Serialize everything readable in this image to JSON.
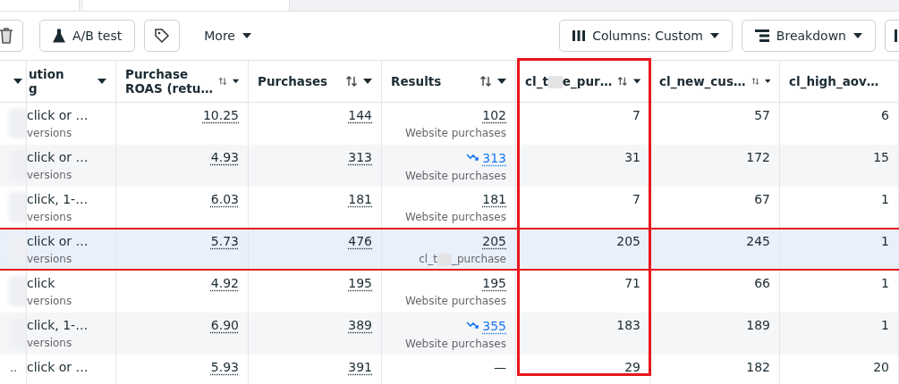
{
  "toolbar": {
    "left": [
      {
        "kind": "trash"
      },
      {
        "kind": "abtest",
        "label": "A/B test"
      },
      {
        "kind": "tag"
      },
      {
        "kind": "menu",
        "label": "More"
      }
    ],
    "right": [
      {
        "kind": "columns",
        "label": "Columns: Custom"
      },
      {
        "kind": "breakdown",
        "label": "Breakdown"
      },
      {
        "kind": "bar"
      }
    ]
  },
  "table": {
    "columns": [
      {
        "kind": "cut"
      },
      {
        "kind": "text",
        "lines": [
          "ution",
          "g"
        ]
      },
      {
        "kind": "num",
        "lines": [
          "Purchase",
          "ROAS (retu…"
        ],
        "highlighted": false
      },
      {
        "kind": "num",
        "lines": [
          "Purchases"
        ],
        "highlighted": false
      },
      {
        "kind": "num",
        "lines": [
          "Results"
        ],
        "highlighted": false
      },
      {
        "kind": "redacted",
        "lines": [
          "cl_t",
          "e_pur…"
        ],
        "highlighted": true
      },
      {
        "kind": "num",
        "lines": [
          "cl_new_cus…"
        ],
        "highlighted": false
      },
      {
        "kind": "num",
        "lines": [
          "cl_high_aov…"
        ],
        "highlighted": false
      }
    ],
    "rows": [
      {
        "selected": false,
        "attribution": "click or …",
        "attribution_sub": "versions",
        "roas": "10.25",
        "purchases": "144",
        "result": "102",
        "result_trend": false,
        "result_sub": [
          "Website purchases"
        ],
        "col_5": "7",
        "col_6": "57",
        "col_7": "6"
      },
      {
        "selected": false,
        "attribution": "click or …",
        "attribution_sub": "versions",
        "roas": "4.93",
        "purchases": "313",
        "result": "313",
        "result_trend": true,
        "result_sub": [
          "Website purchases"
        ],
        "col_5": "31",
        "col_6": "172",
        "col_7": "15"
      },
      {
        "selected": false,
        "attribution": "click, 1-…",
        "attribution_sub": "versions",
        "roas": "6.03",
        "purchases": "181",
        "result": "181",
        "result_trend": false,
        "result_sub": [
          "Website purchases"
        ],
        "col_5": "7",
        "col_6": "67",
        "col_7": "1"
      },
      {
        "selected": true,
        "attribution": "click or …",
        "attribution_sub": "versions",
        "roas": "5.73",
        "purchases": "476",
        "result": "205",
        "result_trend": false,
        "result_sub": [
          "cl_t",
          "_purchase"
        ],
        "col_5": "205",
        "col_6": "245",
        "col_7": "1"
      },
      {
        "selected": false,
        "attribution": "click",
        "attribution_sub": "versions",
        "roas": "4.92",
        "purchases": "195",
        "result": "195",
        "result_trend": false,
        "result_sub": [
          "Website purchases"
        ],
        "col_5": "71",
        "col_6": "66",
        "col_7": "1"
      },
      {
        "selected": false,
        "attribution": "click, 1-…",
        "attribution_sub": "versions",
        "roas": "6.90",
        "purchases": "389",
        "result": "355",
        "result_trend": true,
        "result_sub": [
          "Website purchases"
        ],
        "col_5": "183",
        "col_6": "189",
        "col_7": "1"
      },
      {
        "selected": false,
        "lead": "..",
        "attribution": "click or …",
        "roas": "5.93",
        "purchases": "391",
        "result": "—",
        "result_trend": false,
        "col_5": "29",
        "col_6": "182",
        "col_7": "20"
      }
    ]
  }
}
